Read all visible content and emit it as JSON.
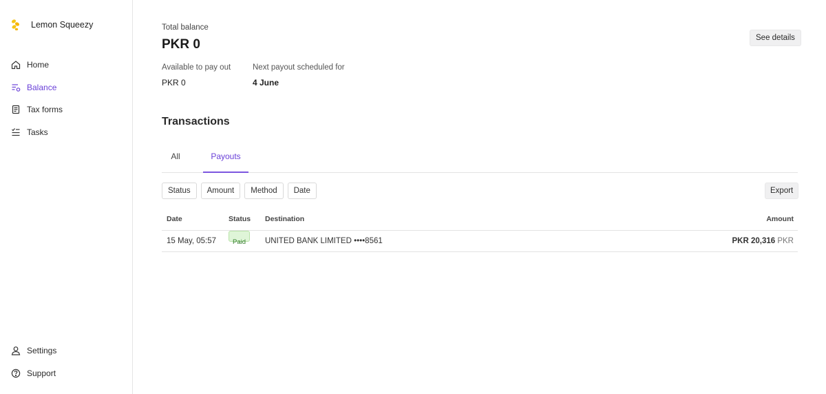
{
  "sidebar": {
    "brand_name": "Lemon Squeezy",
    "items": [
      {
        "label": "Home",
        "icon": "home-icon"
      },
      {
        "label": "Balance",
        "icon": "balance-icon",
        "active": true
      },
      {
        "label": "Tax forms",
        "icon": "document-icon"
      },
      {
        "label": "Tasks",
        "icon": "tasks-icon"
      }
    ],
    "bottom_items": [
      {
        "label": "Settings",
        "icon": "user-icon"
      },
      {
        "label": "Support",
        "icon": "help-icon"
      }
    ]
  },
  "balance": {
    "total_label": "Total balance",
    "total_value": "PKR 0",
    "see_details_label": "See details",
    "available_label": "Available to pay out",
    "available_value": "PKR 0",
    "next_payout_label": "Next payout scheduled for",
    "next_payout_value": "4 June"
  },
  "transactions": {
    "title": "Transactions",
    "tabs": [
      {
        "label": "All",
        "active": false
      },
      {
        "label": "Payouts",
        "active": true
      }
    ],
    "filters": [
      "Status",
      "Amount",
      "Method",
      "Date"
    ],
    "export_label": "Export",
    "columns": {
      "date": "Date",
      "status": "Status",
      "destination": "Destination",
      "amount": "Amount"
    },
    "rows": [
      {
        "date": "15 May, 05:57",
        "status": "Paid",
        "destination": "UNITED BANK LIMITED ••••8561",
        "amount": "PKR 20,316",
        "currency": "PKR"
      }
    ]
  },
  "colors": {
    "accent": "#6a40d8",
    "paid_badge_bg": "#dff5d8",
    "paid_badge_text": "#2f7a27",
    "logo_yellow": "#f5c518"
  }
}
